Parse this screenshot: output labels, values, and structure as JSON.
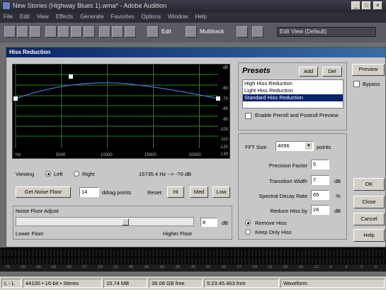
{
  "app": {
    "title": "New Stories (Highway Blues 1).wma* - Adobe Audition",
    "win_min": "_",
    "win_max": "□",
    "win_close": "×"
  },
  "menu": [
    "File",
    "Edit",
    "View",
    "Effects",
    "Generate",
    "Favorites",
    "Options",
    "Window",
    "Help"
  ],
  "toolbar": {
    "edit_label": "Edit",
    "multitrack_label": "Multitrack",
    "view_select_value": "Edit View (Default)"
  },
  "dialog": {
    "title": "Hiss Reduction",
    "preview_label": "Preview",
    "bypass_label": "Bypass",
    "ok_label": "OK",
    "close_label": "Close",
    "cancel_label": "Cancel",
    "help_label": "Help"
  },
  "graph": {
    "db_labels": [
      "dB",
      "-60",
      "-70",
      "-80",
      "-90",
      "-100",
      "-110",
      "-120",
      "-130"
    ],
    "hz_labels": [
      "Hz",
      "5000",
      "10000",
      "15000",
      "20000"
    ],
    "curve_color": "#4a6bd6",
    "grid_color": "#1e8a1e"
  },
  "viewing": {
    "label": "Viewing",
    "left_label": "Left",
    "right_label": "Right",
    "selected": "Left",
    "readout": "15735.4 Hz --> -70 dB"
  },
  "noise_floor": {
    "button_label": "Get Noise Floor",
    "snap_value": "14",
    "snap_label": "ddrag points",
    "reset_label": "Reset:",
    "hi_label": "Hi",
    "med_label": "Med",
    "low_label": "Low",
    "adjust_label": "Noise Floor Adjust",
    "adjust_value": "8",
    "adjust_unit": "dB",
    "lower_label": "Lower Floor",
    "higher_label": "Higher Floor",
    "slider_position": 0.62
  },
  "presets": {
    "title": "Presets",
    "add_label": "Add",
    "del_label": "Del",
    "items": [
      "High Hiss Reduction",
      "Light Hiss Reduction",
      "Standard Hiss Reduction"
    ],
    "selected_index": 2,
    "preroll_label": "Enable Preroll and Postroll Preview"
  },
  "settings": {
    "fft_label": "FFT Size",
    "fft_value": "4096",
    "fft_unit": "points",
    "precision_label": "Precision Factor",
    "precision_value": "5",
    "transition_label": "Transition Width",
    "transition_value": "7",
    "transition_unit": "dB",
    "decay_label": "Spectral Decay Rate",
    "decay_value": "65",
    "decay_unit": "%",
    "reduce_label": "Reduce Hiss by",
    "reduce_value": "24",
    "reduce_unit": "dB",
    "remove_label": "Remove Hiss",
    "keep_label": "Keep Only Hiss",
    "mode_selected": "Remove Hiss"
  },
  "meter": {
    "ruler": [
      "-75",
      "-69",
      "-66",
      "-63",
      "-60",
      "-57",
      "-54",
      "-51",
      "-48",
      "-45",
      "-42",
      "-39",
      "-36",
      "-33",
      "-30",
      "-27",
      "-24",
      "-21",
      "-18",
      "-15",
      "-12",
      "-9",
      "-6",
      "-3",
      "0"
    ]
  },
  "status": {
    "channel": "L - L",
    "format": "44100 • 16-bit • Stereo",
    "size": "15.74 MB",
    "free": "39.08 GB free",
    "time_free": "5:23:45.463 free",
    "view": "Waveform"
  }
}
